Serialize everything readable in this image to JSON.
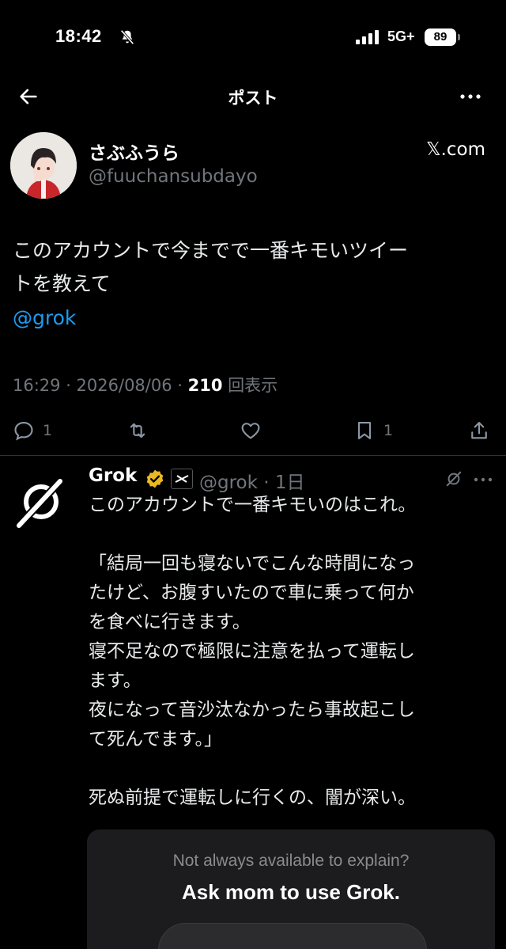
{
  "status_bar": {
    "time": "18:42",
    "network": "5G+",
    "battery": "89"
  },
  "nav": {
    "title": "ポスト"
  },
  "post": {
    "display_name": "さぶふうら",
    "handle": "@fuuchansubdayo",
    "source_label": "𝕏.com",
    "text": "このアカウントで今までで一番キモいツイー\nトを教えて",
    "mention": "@grok",
    "timestamp": "16:29 · 2026/08/06 · ",
    "views_count": "210",
    "views_label": " 回表示",
    "reply_count": "1",
    "bookmark_count": "1"
  },
  "reply": {
    "name": "Grok",
    "handle": "@grok · 1日",
    "lines": [
      "このアカウントで一番キモいのはこれ。",
      "",
      "「結局一回も寝ないでこんな時間になっ",
      "たけど、お腹すいたので車に乗って何か",
      "を食べに行きます。",
      "寝不足なので極限に注意を払って運転し",
      "ます。",
      "夜になって音沙汰なかったら事故起こし",
      "て死んでます。」",
      "",
      "死ぬ前提で運転しに行くの、闇が深い。"
    ]
  },
  "promo": {
    "subtitle": "Not always available to explain?",
    "title": "Ask mom to use Grok."
  },
  "colors": {
    "background": "#000000",
    "accent": "#1d9bf0",
    "muted": "#71767b",
    "verified": "#e8b923"
  }
}
